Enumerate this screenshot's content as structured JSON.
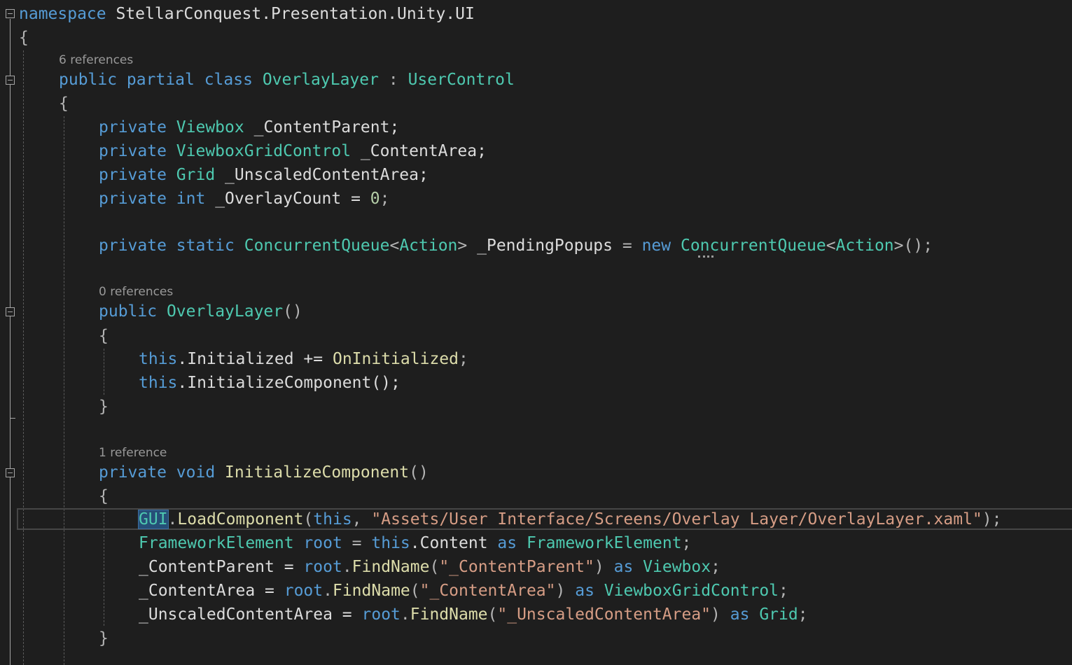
{
  "editor": {
    "code_lens": {
      "class_refs": "6 references",
      "ctor_refs": "0 references",
      "init_refs": "1 reference"
    },
    "namespace_line": {
      "keyword": "namespace",
      "name": "StellarConquest.Presentation.Unity.UI"
    },
    "class_decl": {
      "modifiers": "public partial class",
      "name": "OverlayLayer",
      "colon": ":",
      "base": "UserControl"
    },
    "fields": [
      {
        "modifier": "private",
        "type": "Viewbox",
        "rest": "_ContentParent;"
      },
      {
        "modifier": "private",
        "type": "ViewboxGridControl",
        "rest": "_ContentArea;"
      },
      {
        "modifier": "private",
        "type": "Grid",
        "rest": "_UnscaledContentArea;"
      },
      {
        "modifier": "private",
        "type": "int",
        "rest": "_OverlayCount =",
        "value": "0",
        "end": ";"
      }
    ],
    "static_field": {
      "modifiers": "private static",
      "type": "ConcurrentQueue",
      "lt": "<",
      "generic": "Action",
      "gt": ">",
      "name": "_PendingPopups",
      "eq": "=",
      "new_kw": "new",
      "type2": "ConcurrentQueue",
      "lt2": "<",
      "generic2": "Action",
      "gt2": ">",
      "end": "();"
    },
    "ctor": {
      "modifier": "public",
      "name": "OverlayLayer",
      "params": "()",
      "line1_this": "this",
      "line1_rest": ".Initialized +=",
      "line1_handler": "OnInitialized",
      "line1_end": ";",
      "line2_this": "this",
      "line2_rest": ".InitializeComponent();"
    },
    "init_method": {
      "modifiers": "private void",
      "name": "InitializeComponent",
      "params": "()",
      "l1_cls": "GUI",
      "l1_dot": ".",
      "l1_fn": "LoadComponent",
      "l1_open": "(",
      "l1_this": "this",
      "l1_comma": ",",
      "l1_str": "\"Assets/User Interface/Screens/Overlay Layer/OverlayLayer.xaml\"",
      "l1_end": ");",
      "l2_type": "FrameworkElement",
      "l2_var": "root",
      "l2_eq": "=",
      "l2_this": "this",
      "l2_rest": ".Content",
      "l2_as": "as",
      "l2_type2": "FrameworkElement",
      "l2_end": ";",
      "l3_lhs": "_ContentParent =",
      "l3_root": "root",
      "l3_dot": ".",
      "l3_fn": "FindName",
      "l3_open": "(",
      "l3_str": "\"_ContentParent\"",
      "l3_close": ")",
      "l3_as": "as",
      "l3_type": "Viewbox",
      "l3_end": ";",
      "l4_lhs": "_ContentArea =",
      "l4_root": "root",
      "l4_dot": ".",
      "l4_fn": "FindName",
      "l4_open": "(",
      "l4_str": "\"_ContentArea\"",
      "l4_close": ")",
      "l4_as": "as",
      "l4_type": "ViewboxGridControl",
      "l4_end": ";",
      "l5_lhs": "_UnscaledContentArea =",
      "l5_root": "root",
      "l5_dot": ".",
      "l5_fn": "FindName",
      "l5_open": "(",
      "l5_str": "\"_UnscaledContentArea\"",
      "l5_close": ")",
      "l5_as": "as",
      "l5_type": "Grid",
      "l5_end": ";"
    },
    "braces": {
      "open": "{",
      "close": "}"
    }
  }
}
